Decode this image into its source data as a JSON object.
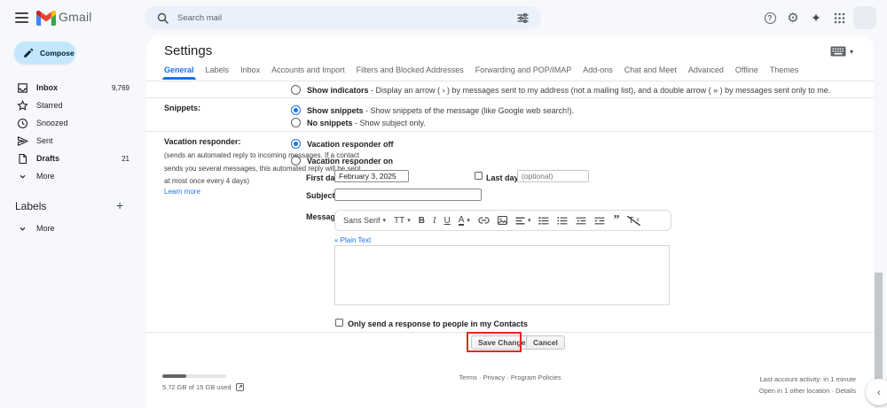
{
  "colors": {
    "accent_blue": "#1a73e8",
    "compose_bg": "#c2e7ff",
    "page_bg": "#f6f8fc",
    "annotation_red": "#e3261d"
  },
  "icons": {
    "help": "?",
    "gear": "⚙",
    "sparkle": "✦",
    "caret": "▾",
    "chevron_left": "‹",
    "plus": "+"
  },
  "header": {
    "logo_text": "Gmail",
    "search_placeholder": "Search mail"
  },
  "sidebar": {
    "compose_label": "Compose",
    "items": [
      {
        "label": "Inbox",
        "count": "9,769"
      },
      {
        "label": "Starred",
        "count": ""
      },
      {
        "label": "Snoozed",
        "count": ""
      },
      {
        "label": "Sent",
        "count": ""
      },
      {
        "label": "Drafts",
        "count": "21"
      },
      {
        "label": "More",
        "count": ""
      }
    ],
    "labels_header": "Labels",
    "labels_more": "More"
  },
  "settings": {
    "title": "Settings",
    "tabs": [
      {
        "label": "General"
      },
      {
        "label": "Labels"
      },
      {
        "label": "Inbox"
      },
      {
        "label": "Accounts and Import"
      },
      {
        "label": "Filters and Blocked Addresses"
      },
      {
        "label": "Forwarding and POP/IMAP"
      },
      {
        "label": "Add-ons"
      },
      {
        "label": "Chat and Meet"
      },
      {
        "label": "Advanced"
      },
      {
        "label": "Offline"
      },
      {
        "label": "Themes"
      }
    ],
    "indicators": {
      "bold": "Show indicators",
      "rest": " - Display an arrow ( › ) by messages sent to my address (not a mailing list), and a double arrow ( » ) by messages sent only to me."
    },
    "snippets": {
      "label": "Snippets:",
      "option_on_bold": "Show snippets",
      "option_on_rest": " - Show snippets of the message (like Google web search!).",
      "option_off_bold": "No snippets",
      "option_off_rest": " - Show subject only."
    },
    "vacation": {
      "label": "Vacation responder:",
      "desc_line1": "(sends an automated reply to incoming messages. If a contact",
      "desc_line2": "sends you several messages, this automated reply will be sent",
      "desc_line3": "at most once every 4 days)",
      "learn_more": "Learn more",
      "off_label": "Vacation responder off",
      "on_label": "Vacation responder on",
      "first_day_label": "First day:",
      "first_day_value": "February 3, 2025",
      "last_day_label": "Last day:",
      "last_day_placeholder": "(optional)",
      "subject_label": "Subject:",
      "message_label": "Message:",
      "plain_text_link": "« Plain Text",
      "contacts_only_label": "Only send a response to people in my Contacts",
      "toolbar": {
        "font_label": "Sans Serif",
        "size_label": "TT",
        "bold": "B",
        "italic": "I",
        "underline": "U",
        "color": "A",
        "quote": "”",
        "clear": "T",
        "clear_sub": "x"
      }
    },
    "buttons": {
      "save": "Save Changes",
      "cancel": "Cancel"
    }
  },
  "footer": {
    "storage": "5.72 GB of 15 GB used",
    "links": [
      "Terms",
      "Privacy",
      "Program Policies"
    ],
    "separator": "·",
    "last_activity": "Last account activity: in 1 minute",
    "open_location": "Open in 1 other location",
    "details": "Details"
  }
}
